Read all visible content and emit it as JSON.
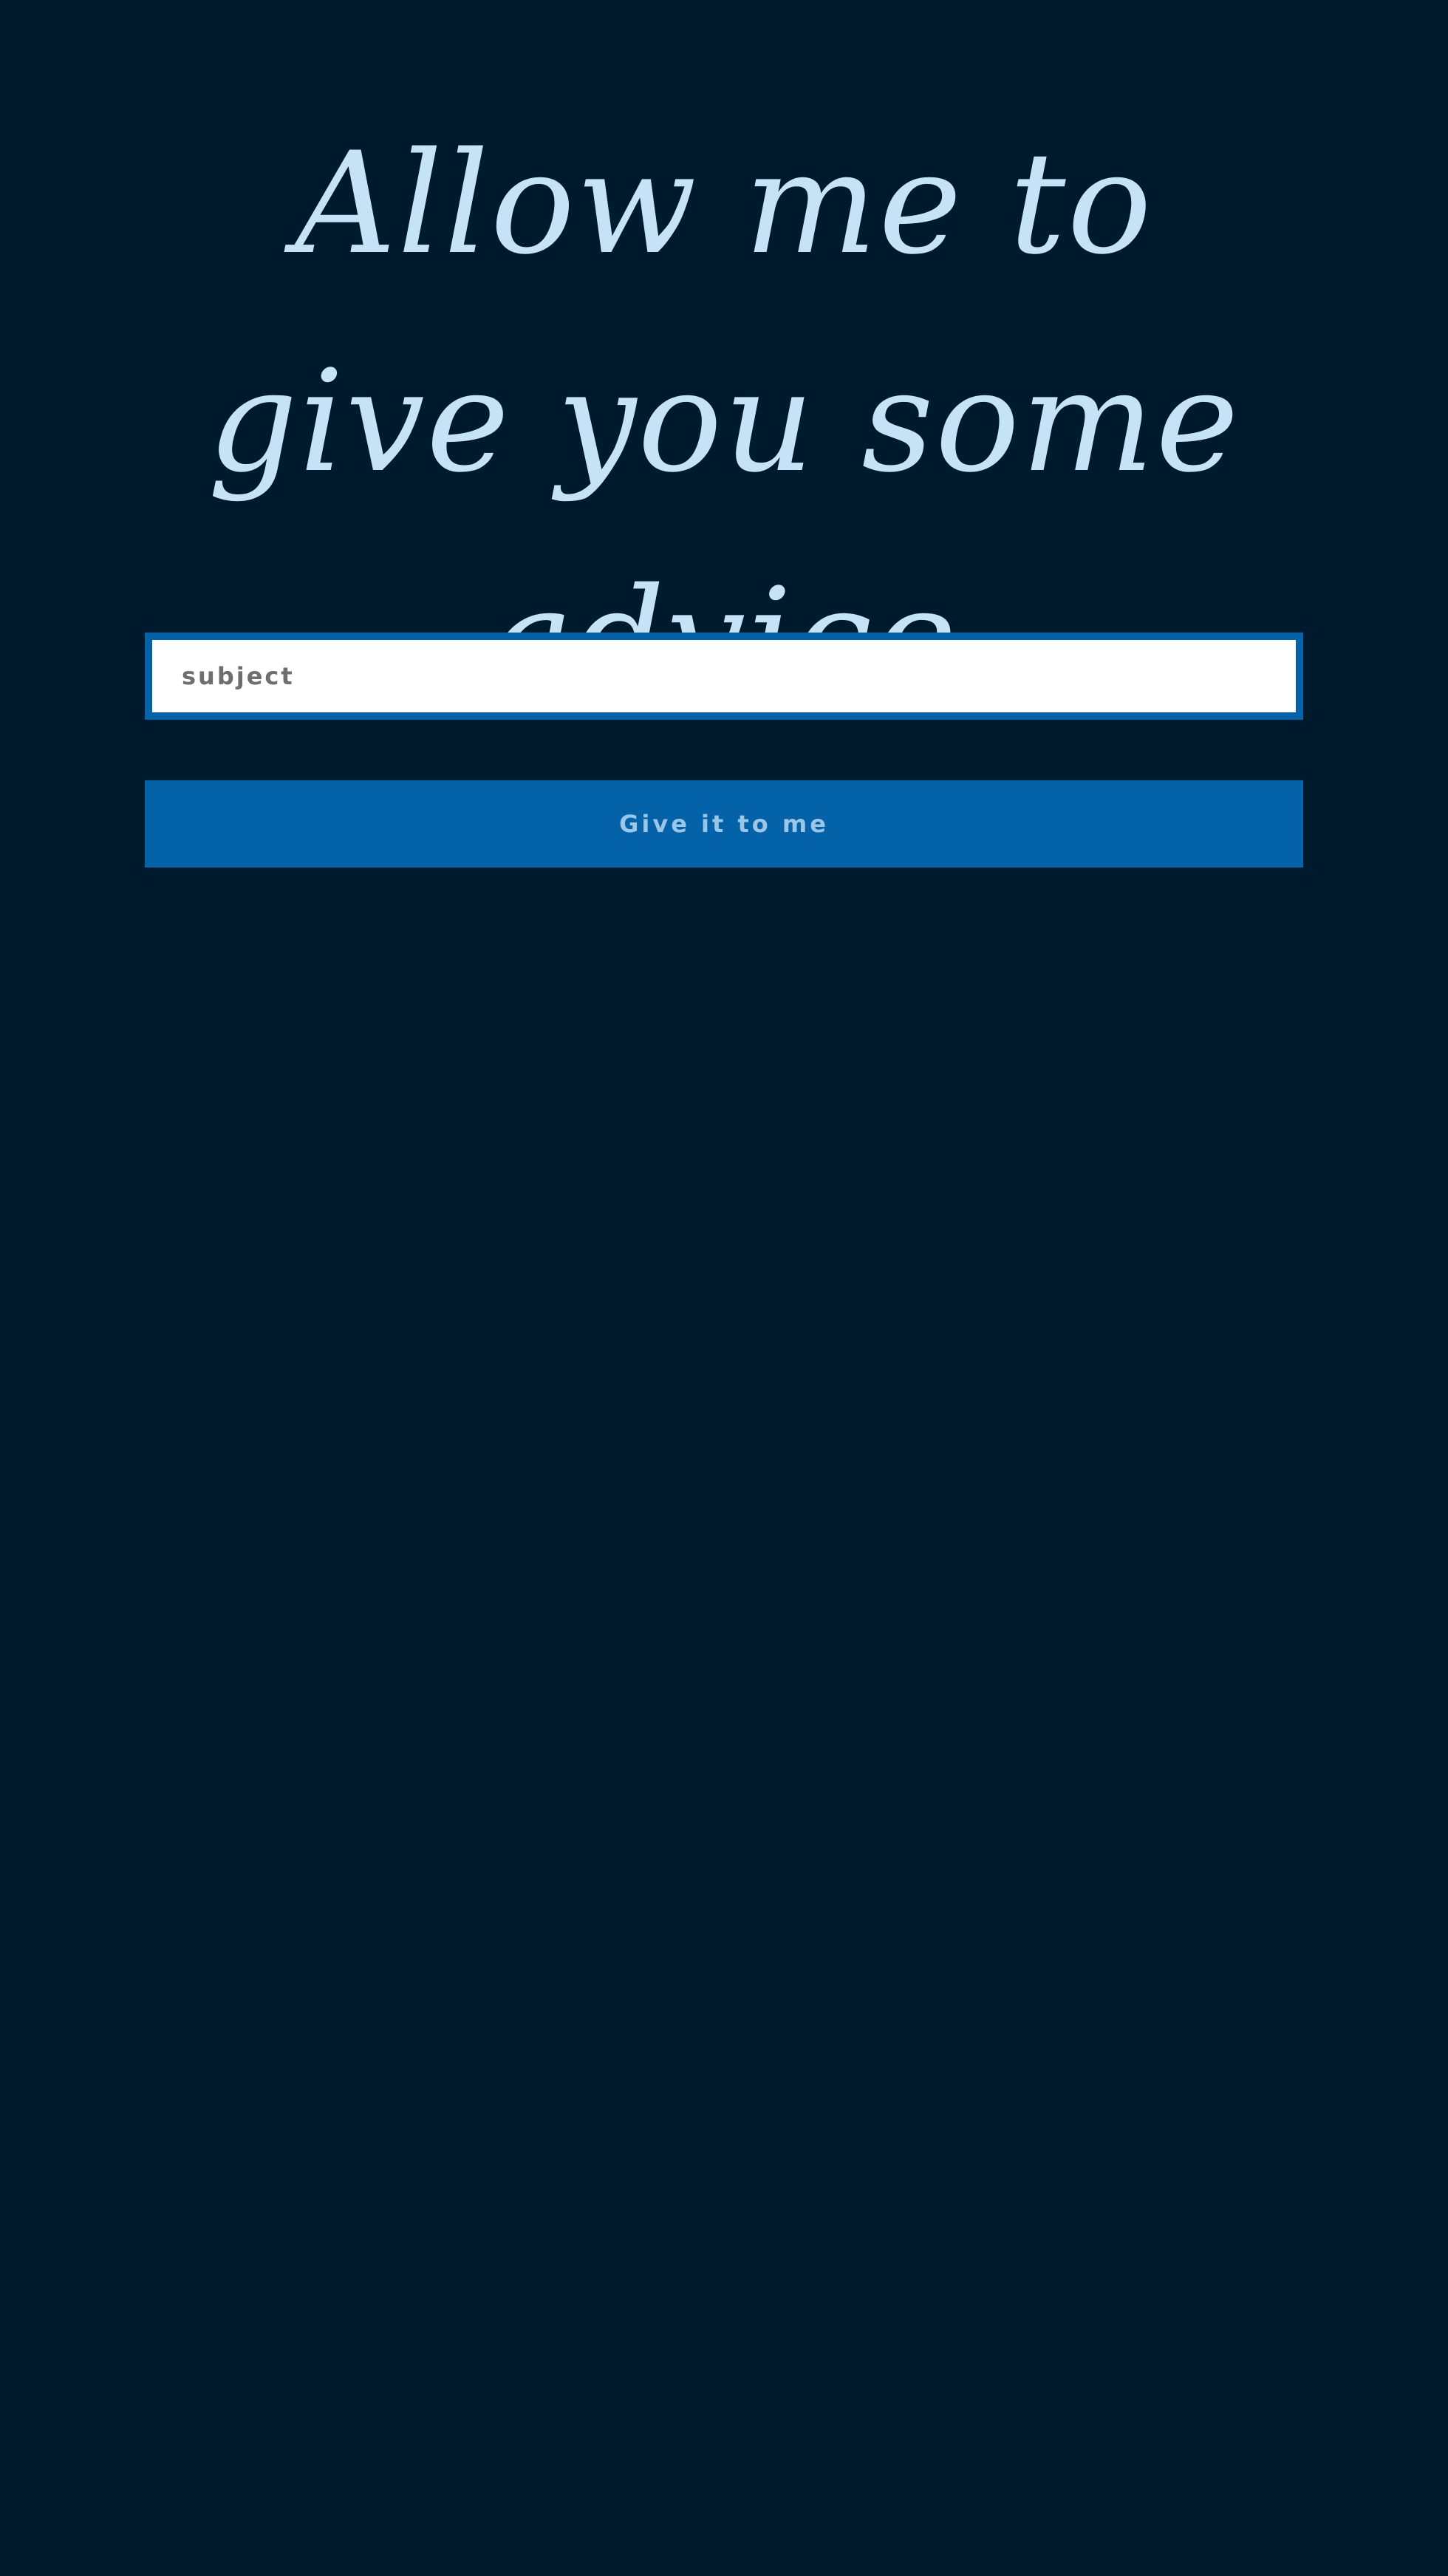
{
  "colors": {
    "background": "#001a2d",
    "headline": "#c6e2f7",
    "accent": "#0462a8",
    "button_text": "#9cc6e6",
    "field_background": "#ffffff",
    "placeholder": "#6e6e6e"
  },
  "hero": {
    "headline": "Allow me to give you some advice"
  },
  "form": {
    "subject": {
      "value": "",
      "placeholder": "subject"
    },
    "submit_label": "Give it to me"
  }
}
